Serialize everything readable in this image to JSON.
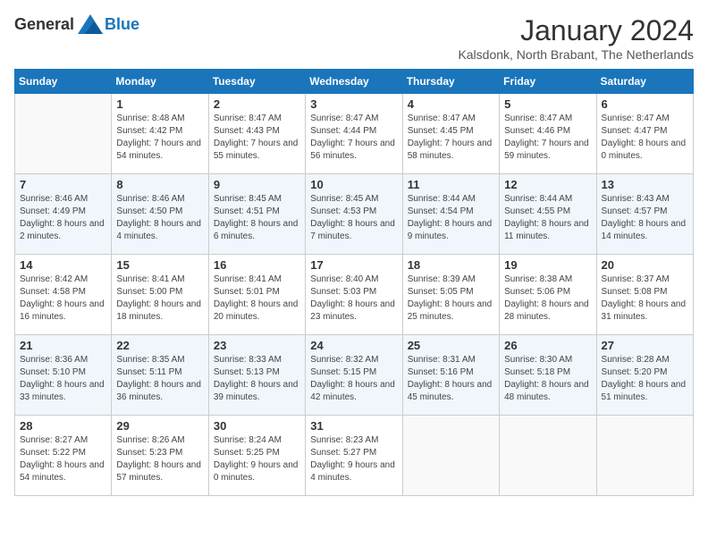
{
  "header": {
    "logo_general": "General",
    "logo_blue": "Blue",
    "month_year": "January 2024",
    "location": "Kalsdonk, North Brabant, The Netherlands"
  },
  "days_of_week": [
    "Sunday",
    "Monday",
    "Tuesday",
    "Wednesday",
    "Thursday",
    "Friday",
    "Saturday"
  ],
  "weeks": [
    {
      "cells": [
        {
          "day": "",
          "empty": true
        },
        {
          "day": "1",
          "sunrise": "8:48 AM",
          "sunset": "4:42 PM",
          "daylight": "7 hours and 54 minutes."
        },
        {
          "day": "2",
          "sunrise": "8:47 AM",
          "sunset": "4:43 PM",
          "daylight": "7 hours and 55 minutes."
        },
        {
          "day": "3",
          "sunrise": "8:47 AM",
          "sunset": "4:44 PM",
          "daylight": "7 hours and 56 minutes."
        },
        {
          "day": "4",
          "sunrise": "8:47 AM",
          "sunset": "4:45 PM",
          "daylight": "7 hours and 58 minutes."
        },
        {
          "day": "5",
          "sunrise": "8:47 AM",
          "sunset": "4:46 PM",
          "daylight": "7 hours and 59 minutes."
        },
        {
          "day": "6",
          "sunrise": "8:47 AM",
          "sunset": "4:47 PM",
          "daylight": "8 hours and 0 minutes."
        }
      ]
    },
    {
      "cells": [
        {
          "day": "7",
          "sunrise": "8:46 AM",
          "sunset": "4:49 PM",
          "daylight": "8 hours and 2 minutes."
        },
        {
          "day": "8",
          "sunrise": "8:46 AM",
          "sunset": "4:50 PM",
          "daylight": "8 hours and 4 minutes."
        },
        {
          "day": "9",
          "sunrise": "8:45 AM",
          "sunset": "4:51 PM",
          "daylight": "8 hours and 6 minutes."
        },
        {
          "day": "10",
          "sunrise": "8:45 AM",
          "sunset": "4:53 PM",
          "daylight": "8 hours and 7 minutes."
        },
        {
          "day": "11",
          "sunrise": "8:44 AM",
          "sunset": "4:54 PM",
          "daylight": "8 hours and 9 minutes."
        },
        {
          "day": "12",
          "sunrise": "8:44 AM",
          "sunset": "4:55 PM",
          "daylight": "8 hours and 11 minutes."
        },
        {
          "day": "13",
          "sunrise": "8:43 AM",
          "sunset": "4:57 PM",
          "daylight": "8 hours and 14 minutes."
        }
      ]
    },
    {
      "cells": [
        {
          "day": "14",
          "sunrise": "8:42 AM",
          "sunset": "4:58 PM",
          "daylight": "8 hours and 16 minutes."
        },
        {
          "day": "15",
          "sunrise": "8:41 AM",
          "sunset": "5:00 PM",
          "daylight": "8 hours and 18 minutes."
        },
        {
          "day": "16",
          "sunrise": "8:41 AM",
          "sunset": "5:01 PM",
          "daylight": "8 hours and 20 minutes."
        },
        {
          "day": "17",
          "sunrise": "8:40 AM",
          "sunset": "5:03 PM",
          "daylight": "8 hours and 23 minutes."
        },
        {
          "day": "18",
          "sunrise": "8:39 AM",
          "sunset": "5:05 PM",
          "daylight": "8 hours and 25 minutes."
        },
        {
          "day": "19",
          "sunrise": "8:38 AM",
          "sunset": "5:06 PM",
          "daylight": "8 hours and 28 minutes."
        },
        {
          "day": "20",
          "sunrise": "8:37 AM",
          "sunset": "5:08 PM",
          "daylight": "8 hours and 31 minutes."
        }
      ]
    },
    {
      "cells": [
        {
          "day": "21",
          "sunrise": "8:36 AM",
          "sunset": "5:10 PM",
          "daylight": "8 hours and 33 minutes."
        },
        {
          "day": "22",
          "sunrise": "8:35 AM",
          "sunset": "5:11 PM",
          "daylight": "8 hours and 36 minutes."
        },
        {
          "day": "23",
          "sunrise": "8:33 AM",
          "sunset": "5:13 PM",
          "daylight": "8 hours and 39 minutes."
        },
        {
          "day": "24",
          "sunrise": "8:32 AM",
          "sunset": "5:15 PM",
          "daylight": "8 hours and 42 minutes."
        },
        {
          "day": "25",
          "sunrise": "8:31 AM",
          "sunset": "5:16 PM",
          "daylight": "8 hours and 45 minutes."
        },
        {
          "day": "26",
          "sunrise": "8:30 AM",
          "sunset": "5:18 PM",
          "daylight": "8 hours and 48 minutes."
        },
        {
          "day": "27",
          "sunrise": "8:28 AM",
          "sunset": "5:20 PM",
          "daylight": "8 hours and 51 minutes."
        }
      ]
    },
    {
      "cells": [
        {
          "day": "28",
          "sunrise": "8:27 AM",
          "sunset": "5:22 PM",
          "daylight": "8 hours and 54 minutes."
        },
        {
          "day": "29",
          "sunrise": "8:26 AM",
          "sunset": "5:23 PM",
          "daylight": "8 hours and 57 minutes."
        },
        {
          "day": "30",
          "sunrise": "8:24 AM",
          "sunset": "5:25 PM",
          "daylight": "9 hours and 0 minutes."
        },
        {
          "day": "31",
          "sunrise": "8:23 AM",
          "sunset": "5:27 PM",
          "daylight": "9 hours and 4 minutes."
        },
        {
          "day": "",
          "empty": true
        },
        {
          "day": "",
          "empty": true
        },
        {
          "day": "",
          "empty": true
        }
      ]
    }
  ]
}
